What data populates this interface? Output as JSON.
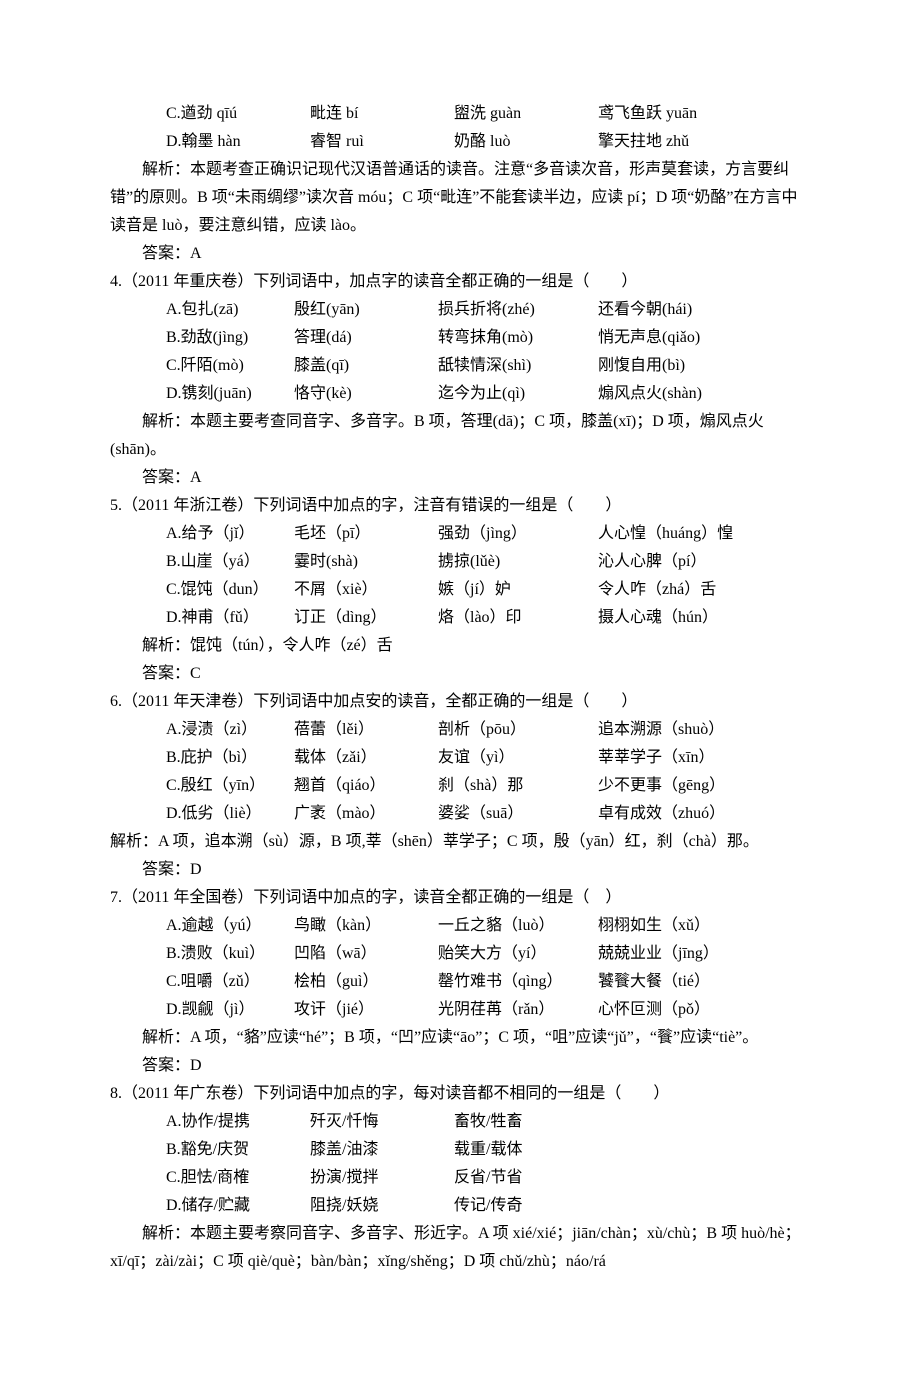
{
  "pre": {
    "opts": [
      {
        "a": "C.遒劲 qīú",
        "b": "毗连 bí",
        "c": "盥洗 guàn",
        "d": "鸢飞鱼跃 yuān"
      },
      {
        "a": "D.翰墨 hàn",
        "b": "睿智 ruì",
        "c": "奶酪 luò",
        "d": "擎天拄地 zhǔ"
      }
    ],
    "explain": "解析：本题考查正确识记现代汉语普通话的读音。注意“多音读次音，形声莫套读，方言要纠错”的原则。B 项“未雨绸缪”读次音 móu；C 项“毗连”不能套读半边，应读 pí；D 项“奶酪”在方言中读音是 luò，要注意纠错，应读 lào。",
    "answer": "答案：A"
  },
  "q4": {
    "lead": "4.（2011 年重庆卷）下列词语中，加点字的读音全都正确的一组是（　　）",
    "opts": [
      {
        "a": "A.包扎(zā)",
        "b": "殷红(yān)",
        "c": "损兵折将(zhé)",
        "d": "还看今朝(hái)"
      },
      {
        "a": "B.劲敌(jìng)",
        "b": "答理(dá)",
        "c": "转弯抹角(mò)",
        "d": "悄无声息(qiǎo)"
      },
      {
        "a": "C.阡陌(mò)",
        "b": "膝盖(qī)",
        "c": "舐犊情深(shì)",
        "d": "刚愎自用(bì)"
      },
      {
        "a": "D.镌刻(juān)",
        "b": "恪守(kè)",
        "c": "迄今为止(qì)",
        "d": "煽风点火(shàn)"
      }
    ],
    "explain": "解析：本题主要考查同音字、多音字。B 项，答理(dā)；C 项，膝盖(xī)；D 项，煽风点火(shān)。",
    "answer": "答案：A"
  },
  "q5": {
    "lead": "5.（2011 年浙江卷）下列词语中加点的字，注音有错误的一组是（　　）",
    "opts": [
      {
        "a": "A.给予（jǐ）",
        "b": "毛坯（pī）",
        "c": "强劲（jìng）",
        "d": "人心惶（huáng）惶"
      },
      {
        "a": "B.山崖（yá）",
        "b": "霎时(shà)",
        "c": "掳掠(lǔè)",
        "d": "沁人心脾（pí）"
      },
      {
        "a": "C.馄饨（dun）",
        "b": "不屑（xiè）",
        "c": "嫉（jí）妒",
        "d": "令人咋（zhá）舌"
      },
      {
        "a": "D.神甫（fǔ）",
        "b": "订正（dìng）",
        "c": "烙（lào）印",
        "d": "摄人心魂（hún）"
      }
    ],
    "explain": "解析：馄饨（tún），令人咋（zé）舌",
    "answer": "答案：C"
  },
  "q6": {
    "lead": "6.（2011 年天津卷）下列词语中加点安的读音，全都正确的一组是（　　）",
    "opts": [
      {
        "a": "A.浸渍（zì）",
        "b": "蓓蕾（lěi）",
        "c": "剖析（pōu）",
        "d": "追本溯源（shuò）"
      },
      {
        "a": "B.庇护（bì）",
        "b": "载体（zǎi）",
        "c": "友谊（yì）",
        "d": "莘莘学子（xīn）"
      },
      {
        "a": "C.殷红（yīn）",
        "b": "翘首（qiáo）",
        "c": "刹（shà）那",
        "d": "少不更事（gēng）"
      },
      {
        "a": "D.低劣（liè）",
        "b": "广袤（mào）",
        "c": "婆娑（suā）",
        "d": "卓有成效（zhuó）"
      }
    ],
    "explain": "解析：A 项，追本溯（sù）源，B 项,莘（shēn）莘学子；C 项，殷（yān）红，刹（chà）那。",
    "answer": "答案：D"
  },
  "q7": {
    "lead": "7.（2011 年全国卷）下列词语中加点的字，读音全都正确的一组是（　）",
    "opts": [
      {
        "a": "A.逾越（yú）",
        "b": "鸟瞰（kàn）",
        "c": "一丘之貉（luò）",
        "d": "栩栩如生（xǔ）"
      },
      {
        "a": "B.溃败（kuì）",
        "b": "凹陷（wā）",
        "c": "贻笑大方（yí）",
        "d": "兢兢业业（jīng）"
      },
      {
        "a": "C.咀嚼（zǔ）",
        "b": "桧柏（guì）",
        "c": "罄竹难书（qìng）",
        "d": "饕餮大餐（tié）"
      },
      {
        "a": "D.觊觎（jì）",
        "b": "攻讦（jié）",
        "c": "光阴荏苒（rǎn）",
        "d": "心怀叵测（pǒ）"
      }
    ],
    "explain": "解析：A 项，“貉”应读“hé”；B 项，“凹”应读“āo”；C 项，“咀”应读“jǔ”，“餮”应读“tiè”。",
    "answer": "答案：D"
  },
  "q8": {
    "lead": "8.（2011 年广东卷）下列词语中加点的字，每对读音都不相同的一组是（　　）",
    "opts": [
      {
        "a": "A.协作/提携",
        "b": "歼灭/忏悔",
        "c": "畜牧/牲畜"
      },
      {
        "a": "B.豁免/庆贺",
        "b": "膝盖/油漆",
        "c": "载重/载体"
      },
      {
        "a": "C.胆怯/商榷",
        "b": "扮演/搅拌",
        "c": "反省/节省"
      },
      {
        "a": "D.储存/贮藏",
        "b": "阻挠/妖娆",
        "c": "传记/传奇"
      }
    ],
    "explain": "解析：本题主要考察同音字、多音字、形近字。A 项 xié/xié；jiān/chàn；xù/chù；B 项 huò/hè；xī/qī；zài/zài；C 项 qiè/què；bàn/bàn；xǐng/shěng；D 项 chǔ/zhù；náo/rá"
  }
}
